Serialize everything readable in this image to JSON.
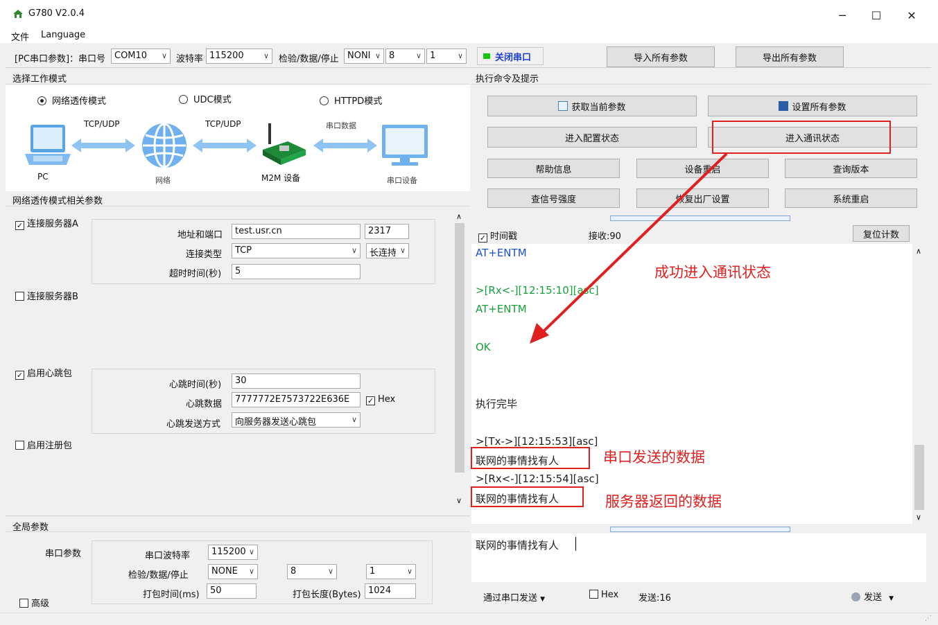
{
  "window": {
    "title": "G780 V2.0.4",
    "minimize": "─",
    "maximize": "☐",
    "close": "✕"
  },
  "menubar": {
    "items": [
      "文件",
      "Language"
    ]
  },
  "serial_toolbar": {
    "label": "[PC串口参数]：串口号",
    "port_value": "COM10",
    "baud_label": "波特率",
    "baud_value": "115200",
    "check_label": "检验/数据/停止",
    "parity_value": "NONI",
    "databits_value": "8",
    "stopbits_value": "1",
    "close_port": "关闭串口",
    "import_all": "导入所有参数",
    "export_all": "导出所有参数",
    "port_status_color": "#16c60c"
  },
  "mode_section": {
    "title": "选择工作模式",
    "modes": [
      "网络透传模式",
      "UDC模式",
      "HTTPD模式"
    ],
    "selected": 0,
    "diagram": {
      "pc": "PC",
      "tcp1": "TCP/UDP",
      "network": "网络",
      "tcp2": "TCP/UDP",
      "m2m": "M2M 设备",
      "serial_data": "串口数据",
      "serial_device": "串口设备"
    }
  },
  "params_section": {
    "title": "网络透传模式相关参数",
    "serverA": {
      "label": "连接服务器A",
      "checked": true,
      "addr_label": "地址和端口",
      "addr_value": "test.usr.cn",
      "port_value": "2317",
      "type_label": "连接类型",
      "type_value": "TCP",
      "conn_value": "长连持",
      "timeout_label": "超时时间(秒)",
      "timeout_value": "5"
    },
    "serverB": {
      "label": "连接服务器B",
      "checked": false
    },
    "heartbeat": {
      "label": "启用心跳包",
      "checked": true,
      "time_label": "心跳时间(秒)",
      "time_value": "30",
      "data_label": "心跳数据",
      "data_value": "7777772E7573722E636E",
      "hex_label": "Hex",
      "mode_label": "心跳发送方式",
      "mode_value": "向服务器发送心跳包"
    },
    "register": {
      "label": "启用注册包",
      "checked": false
    }
  },
  "global_section": {
    "title": "全局参数",
    "serial_params": "串口参数",
    "baud_label": "串口波特率",
    "baud_value": "115200",
    "check_label": "检验/数据/停止",
    "parity_value": "NONE",
    "databits_value": "8",
    "stopbits_value": "1",
    "pack_time_label": "打包时间(ms)",
    "pack_time_value": "50",
    "pack_len_label": "打包长度(Bytes)",
    "pack_len_value": "1024",
    "advanced_label": "高级"
  },
  "cmd_section": {
    "title": "执行命令及提示",
    "get_params": "获取当前参数",
    "set_all": "设置所有参数",
    "enter_config": "进入配置状态",
    "enter_comm": "进入通讯状态",
    "help": "帮助信息",
    "restart_dev": "设备重启",
    "query_ver": "查询版本",
    "signal": "查信号强度",
    "factory": "恢复出厂设置",
    "sys_restart": "系统重启"
  },
  "log": {
    "timestamp_label": "时间戳",
    "recv_count": "接收:90",
    "reset_count": "复位计数",
    "lines": [
      "AT+ENTM",
      ">[Rx<-][12:15:10][asc]",
      "AT+ENTM",
      "OK",
      "执行完毕",
      ">[Tx->][12:15:53][asc]",
      "联网的事情找有人",
      ">[Rx<-][12:15:54][asc]",
      "联网的事情找有人"
    ]
  },
  "send_area": {
    "text": "联网的事情找有人",
    "via_serial": "通过串口发送",
    "hex_label": "Hex",
    "sent_count": "发送:16",
    "send_button": "发送"
  },
  "annotations": {
    "success": "成功进入通讯状态",
    "serial_sent": "串口发送的数据",
    "server_returned": "服务器返回的数据",
    "color": "#e02020"
  }
}
